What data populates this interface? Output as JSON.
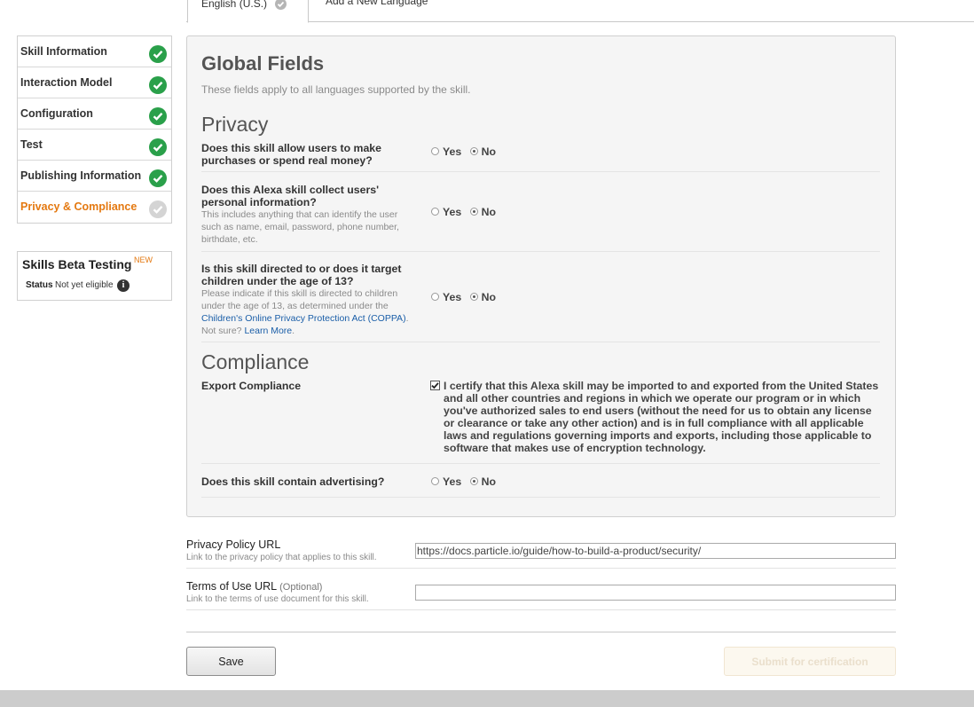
{
  "tabs": {
    "active_label": "English (U.S.)",
    "add_label": "Add a New Language"
  },
  "nav": {
    "items": [
      {
        "label": "Skill Information",
        "status": "complete"
      },
      {
        "label": "Interaction Model",
        "status": "complete"
      },
      {
        "label": "Configuration",
        "status": "complete"
      },
      {
        "label": "Test",
        "status": "complete"
      },
      {
        "label": "Publishing Information",
        "status": "complete"
      },
      {
        "label": "Privacy & Compliance",
        "status": "pending"
      }
    ],
    "current_color": "#e47911",
    "complete_color": "#2aa04a"
  },
  "beta": {
    "title": "Skills Beta Testing",
    "badge": "NEW",
    "status_label": "Status",
    "status_value": "Not yet eligible",
    "info_icon": "i"
  },
  "global": {
    "title": "Global Fields",
    "subtitle": "These fields apply to all languages supported by the skill.",
    "privacy_heading": "Privacy",
    "compliance_heading": "Compliance",
    "yes_label": "Yes",
    "no_label": "No",
    "q1": {
      "text": "Does this skill allow users to make purchases or spend real money?",
      "answer": "No"
    },
    "q2": {
      "text": "Does this Alexa skill collect users' personal information?",
      "help": "This includes anything that can identify the user such as name, email, password, phone number, birthdate, etc.",
      "answer": "No"
    },
    "q3": {
      "text": "Is this skill directed to or does it target children under the age of 13?",
      "help_before": "Please indicate if this skill is directed to children under the age of 13, as determined under the ",
      "coppa_link": "Children's Online Privacy Protection Act (COPPA)",
      "help_mid": ". Not sure? ",
      "learn_more_link": "Learn More",
      "help_end": ".",
      "answer": "No"
    },
    "export_label": "Export Compliance",
    "export_text": "I certify that this Alexa skill may be imported to and exported from the United States and all other countries and regions in which we operate our program or in which you've authorized sales to end users (without the need for us to obtain any license or clearance or take any other action) and is in full compliance with all applicable laws and regulations governing imports and exports, including those applicable to software that makes use of encryption technology.",
    "export_checked": true,
    "q4": {
      "text": "Does this skill contain advertising?",
      "answer": "No"
    }
  },
  "privacy_url": {
    "label": "Privacy Policy URL",
    "help": "Link to the privacy policy that applies to this skill.",
    "value": "https://docs.particle.io/guide/how-to-build-a-product/security/"
  },
  "terms_url": {
    "label": "Terms of Use URL",
    "optional": "(Optional)",
    "help": "Link to the terms of use document for this skill.",
    "value": ""
  },
  "buttons": {
    "save": "Save",
    "submit": "Submit for certification"
  }
}
